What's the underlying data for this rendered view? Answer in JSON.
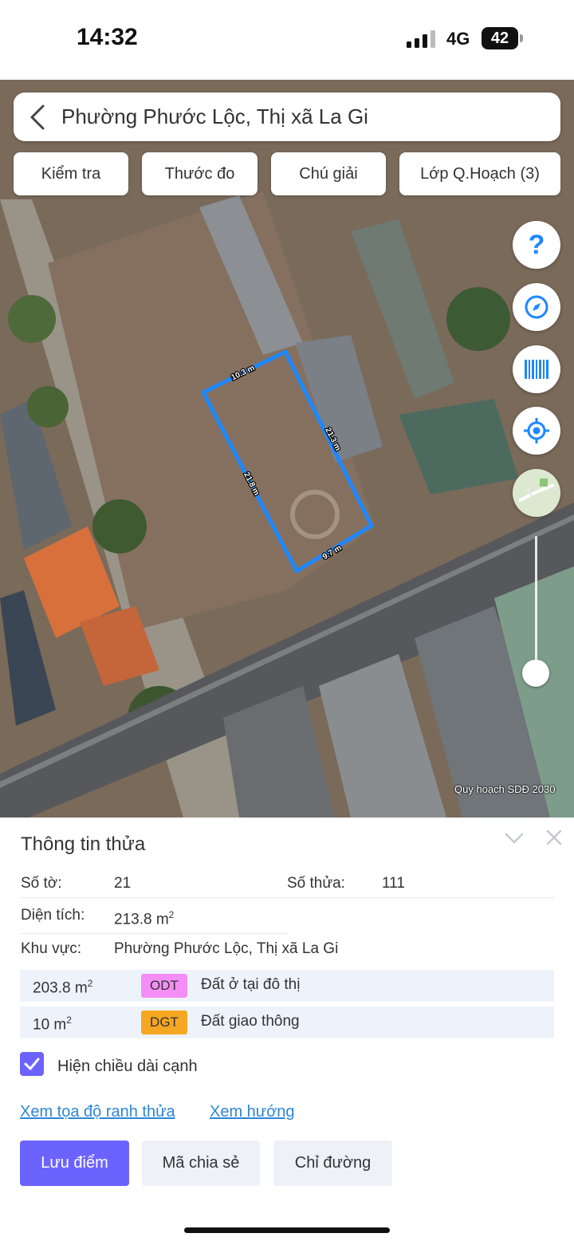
{
  "status_bar": {
    "time": "14:32",
    "network": "4G",
    "battery": "42"
  },
  "map": {
    "search_title": "Phường Phước Lộc, Thị xã La Gi",
    "chips": [
      "Kiểm tra",
      "Thước đo",
      "Chú giải",
      "Lớp Q.Hoạch (3)"
    ],
    "parcel_edges": [
      "10.3 m",
      "21.3 m",
      "21.8 m",
      "9.7 m"
    ],
    "parcel_color": "#1e88ff",
    "watermark": "Quy hoạch SDĐ 2030",
    "controls": [
      "help-icon",
      "compass-icon",
      "barcode-icon",
      "locate-icon",
      "map-layer-icon"
    ]
  },
  "panel": {
    "title": "Thông tin thửa",
    "sheet_label": "Số tờ:",
    "sheet_value": "21",
    "parcel_label": "Số thửa:",
    "parcel_value": "111",
    "area_label": "Diện tích:",
    "area_value": "213.8 m",
    "area_unit_sup": "2",
    "region_label": "Khu vực:",
    "region_value": "Phường Phước Lộc, Thị xã La Gi",
    "land_uses": [
      {
        "area": "203.8 m",
        "sup": "2",
        "code": "ODT",
        "name": "Đất ở tại đô thị",
        "color": "#f48ef6"
      },
      {
        "area": "10 m",
        "sup": "2",
        "code": "DGT",
        "name": "Đất giao thông",
        "color": "#f5a623"
      }
    ],
    "show_edges_label": "Hiện chiều dài cạnh",
    "show_edges_checked": true,
    "link_coords": "Xem tọa độ ranh thửa",
    "link_direction": "Xem hướng",
    "buttons": {
      "save": "Lưu điểm",
      "share": "Mã chia sẻ",
      "directions": "Chỉ đường"
    },
    "accent_color": "#6c63ff"
  }
}
